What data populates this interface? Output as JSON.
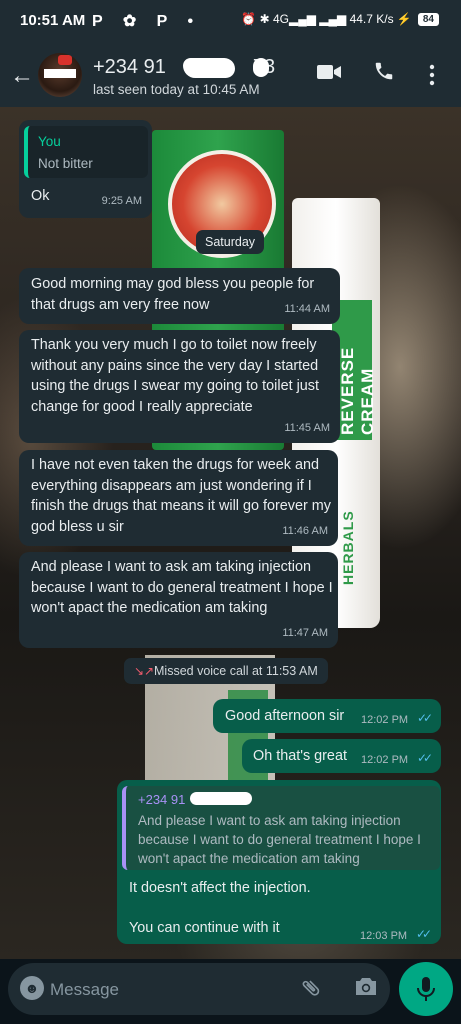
{
  "status_bar": {
    "time": "10:51 AM",
    "left_icons": "P ✿ P •",
    "right_icons": "⏰ ✱ 4G▂▄▆ ▂▄▆ 44.7 K/s ⚡",
    "battery": "84"
  },
  "header": {
    "contact_name": "+234 91",
    "contact_name_tail": "73",
    "last_seen": "last seen today at 10:45 AM"
  },
  "chat": {
    "msg1": {
      "reply_author": "You",
      "reply_text": "Not bitter",
      "text": "Ok",
      "time": "9:25 AM"
    },
    "date_chip": "Saturday",
    "msg2": {
      "text": "Good morning may god bless you people for that drugs am very free now",
      "time": "11:44 AM"
    },
    "msg3": {
      "text": "Thank you very much I go to toilet now freely without any pains since the very day I started using the drugs I swear my going to toilet just change for good I really appreciate",
      "time": "11:45 AM"
    },
    "msg4": {
      "text": "I have not even taken the drugs for week and everything disappears am just wondering if I finish the drugs that means it will go forever my god bless u sir",
      "time": "11:46 AM"
    },
    "msg5": {
      "text": "And please I want to ask am taking injection because I want to do general treatment I hope I won't apact the medication am taking",
      "time": "11:47 AM"
    },
    "missed_call": "Missed voice call at 11:53 AM",
    "msg6": {
      "text": "Good afternoon sir",
      "time": "12:02 PM"
    },
    "msg7": {
      "text": "Oh that's great",
      "time": "12:02 PM"
    },
    "msg8": {
      "reply_author": "+234 91",
      "reply_text": "And please I want to ask am taking injection because I want to do general treatment I hope I won't apact the medication am taking",
      "text1": "It doesn't affect the injection.",
      "text2": "You can continue with it",
      "time": "12:03 PM"
    }
  },
  "wallpaper": {
    "tube_label": "REVERSE CREAM",
    "tube_label2": "HERBALS"
  },
  "input": {
    "placeholder": "Message"
  },
  "icons": {
    "back": "back-arrow-icon",
    "video": "video-call-icon",
    "call": "phone-icon",
    "menu": "more-vert-icon",
    "emoji": "emoji-icon",
    "attach": "paperclip-icon",
    "camera": "camera-icon",
    "mic": "mic-icon"
  },
  "colors": {
    "header_bg": "#1f2c33",
    "incoming_bubble": "#1f2c33",
    "outgoing_bubble": "#075e4a",
    "accent": "#00a884",
    "read_ticks": "#53bdeb"
  }
}
